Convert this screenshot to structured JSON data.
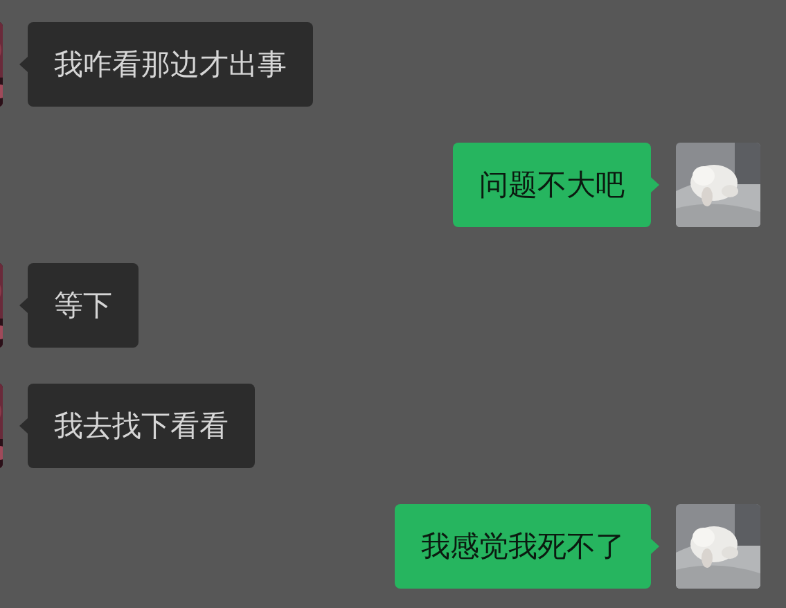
{
  "messages": [
    {
      "kind": "incoming",
      "text": "我咋看那边才出事"
    },
    {
      "kind": "outgoing",
      "text": "问题不大吧"
    },
    {
      "kind": "incoming",
      "text": "等下"
    },
    {
      "kind": "incoming",
      "text": "我去找下看看"
    },
    {
      "kind": "outgoing",
      "text": "我感觉我死不了"
    }
  ]
}
